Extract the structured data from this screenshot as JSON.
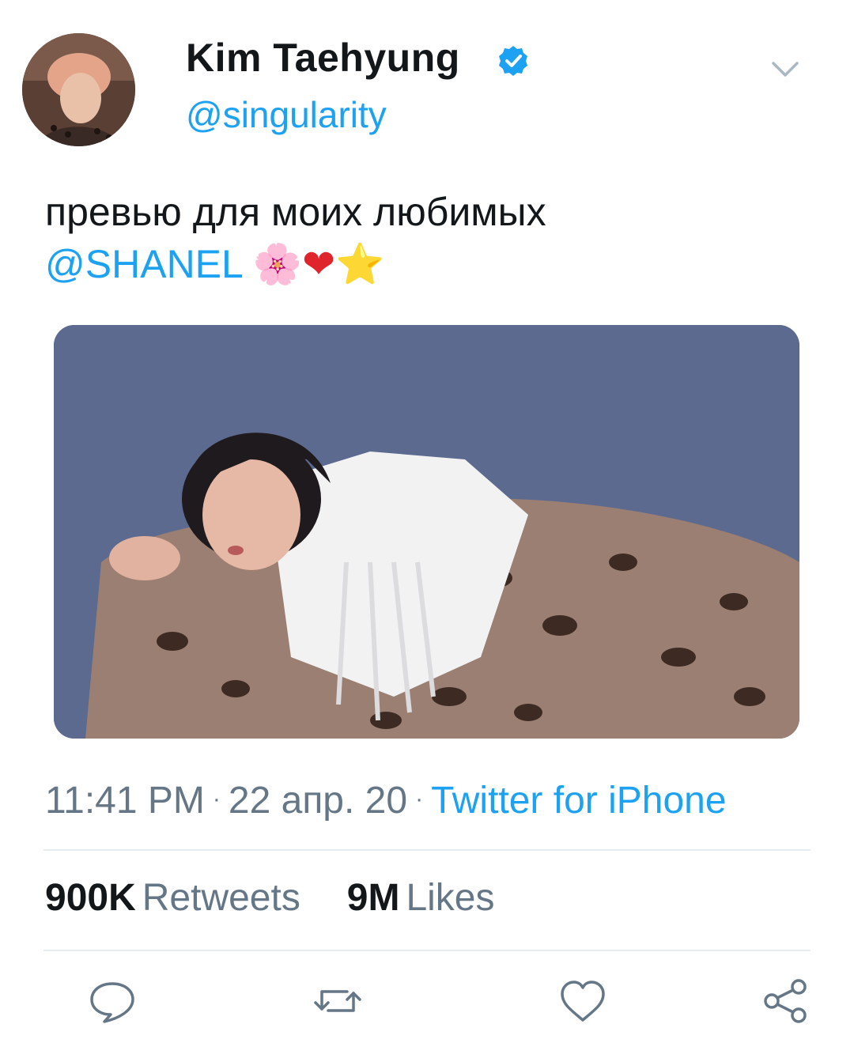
{
  "author": {
    "display_name": "Kim Taehyung",
    "handle": "@singularity",
    "verified_icon": "verified-badge-icon"
  },
  "tweet": {
    "text_line1": "превью для моих любимых",
    "mention": "@SHANEL",
    "emojis": [
      "🌸",
      "❤",
      "⭐"
    ]
  },
  "meta": {
    "time": "11:41 PM",
    "date": "22 апр. 20",
    "separator": "·",
    "source": "Twitter for iPhone"
  },
  "stats": {
    "retweets_count": "900K",
    "retweets_label": "Retweets",
    "likes_count": "9M",
    "likes_label": "Likes"
  },
  "actions": [
    "reply-icon",
    "retweet-icon",
    "like-icon",
    "share-icon"
  ],
  "colors": {
    "accent": "#1da1f2",
    "text": "#14171a",
    "muted": "#657786",
    "divider": "#e6ecf0"
  }
}
